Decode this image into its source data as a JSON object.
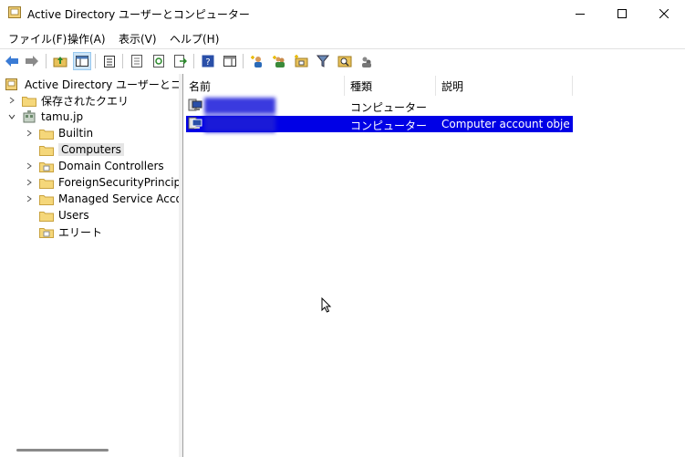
{
  "window": {
    "title": "Active Directory ユーザーとコンピューター"
  },
  "menu": [
    "ファイル(F)",
    "操作(A)",
    "表示(V)",
    "ヘルプ(H)"
  ],
  "tree": {
    "root": "Active Directory ユーザーとコンピュータ",
    "saved_queries": "保存されたクエリ",
    "domain": "tamu.jp",
    "children": [
      "Builtin",
      "Computers",
      "Domain Controllers",
      "ForeignSecurityPrincipals",
      "Managed Service Accounts",
      "Users",
      "エリート"
    ],
    "selected": "Computers"
  },
  "list": {
    "columns": [
      "名前",
      "種類",
      "説明"
    ],
    "rows": [
      {
        "name": "",
        "type": "コンピューター",
        "description": ""
      },
      {
        "name": "",
        "type": "コンピューター",
        "description": "Computer account obje..."
      }
    ],
    "selected_row": 1
  },
  "colors": {
    "selection": "#0000e6",
    "tree_selection": "#e5e5e5"
  }
}
